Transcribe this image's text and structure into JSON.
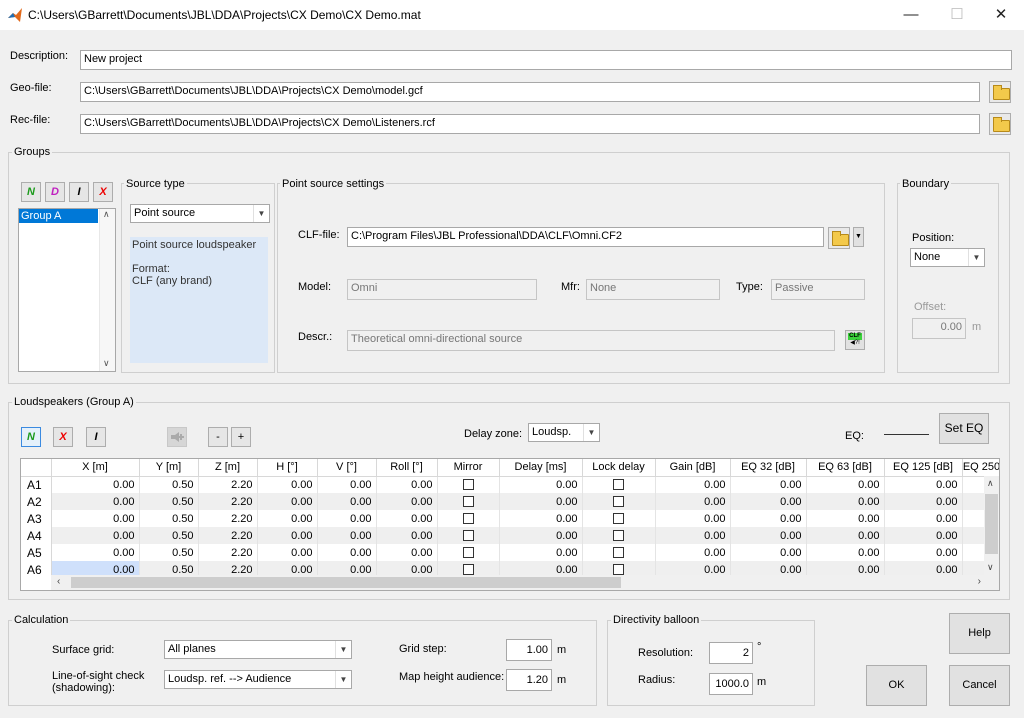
{
  "window": {
    "title": "C:\\Users\\GBarrett\\Documents\\JBL\\DDA\\Projects\\CX Demo\\CX Demo.mat",
    "min": "—",
    "max": "☐",
    "close": "✕"
  },
  "files": {
    "description_label": "Description:",
    "description_value": "New project",
    "geo_label": "Geo-file:",
    "geo_value": "C:\\Users\\GBarrett\\Documents\\JBL\\DDA\\Projects\\CX Demo\\model.gcf",
    "rec_label": "Rec-file:",
    "rec_value": "C:\\Users\\GBarrett\\Documents\\JBL\\DDA\\Projects\\CX Demo\\Listeners.rcf"
  },
  "groups": {
    "label": "Groups",
    "buttons": {
      "new": "N",
      "dup": "D",
      "info": "I",
      "del": "X"
    },
    "items": [
      "Group A"
    ],
    "source_type": {
      "label": "Source type",
      "selected": "Point source",
      "desc_line1": "Point source loudspeaker",
      "desc_line2": "Format:",
      "desc_line3": "CLF (any brand)"
    },
    "point_source": {
      "label": "Point source settings",
      "clf_label": "CLF-file:",
      "clf_value": "C:\\Program Files\\JBL Professional\\DDA\\CLF\\Omni.CF2",
      "model_label": "Model:",
      "model_value": "Omni",
      "mfr_label": "Mfr:",
      "mfr_value": "None",
      "type_label": "Type:",
      "type_value": "Passive",
      "descr_label": "Descr.:",
      "descr_value": "Theoretical omni-directional source",
      "clf_icon_text": "CLF"
    },
    "boundary": {
      "label": "Boundary",
      "position_label": "Position:",
      "position_value": "None",
      "offset_label": "Offset:",
      "offset_value": "0.00",
      "offset_unit": "m"
    }
  },
  "loudspeakers": {
    "label": "Loudspeakers (Group A)",
    "buttons": {
      "new": "N",
      "del": "X",
      "info": "I",
      "minus": "-",
      "plus": "+",
      "set_eq": "Set EQ"
    },
    "delay_zone_label": "Delay zone:",
    "delay_zone_value": "Loudsp.",
    "eq_label": "EQ:",
    "columns": [
      "X [m]",
      "Y [m]",
      "Z [m]",
      "H [°]",
      "V [°]",
      "Roll [°]",
      "Mirror",
      "Delay [ms]",
      "Lock delay",
      "Gain [dB]",
      "EQ 32 [dB]",
      "EQ 63 [dB]",
      "EQ 125 [dB]",
      "EQ 250"
    ],
    "rows": [
      {
        "id": "A1",
        "x": "0.00",
        "y": "0.50",
        "z": "2.20",
        "h": "0.00",
        "v": "0.00",
        "roll": "0.00",
        "delay": "0.00",
        "gain": "0.00",
        "eq32": "0.00",
        "eq63": "0.00",
        "eq125": "0.00"
      },
      {
        "id": "A2",
        "x": "0.00",
        "y": "0.50",
        "z": "2.20",
        "h": "0.00",
        "v": "0.00",
        "roll": "0.00",
        "delay": "0.00",
        "gain": "0.00",
        "eq32": "0.00",
        "eq63": "0.00",
        "eq125": "0.00"
      },
      {
        "id": "A3",
        "x": "0.00",
        "y": "0.50",
        "z": "2.20",
        "h": "0.00",
        "v": "0.00",
        "roll": "0.00",
        "delay": "0.00",
        "gain": "0.00",
        "eq32": "0.00",
        "eq63": "0.00",
        "eq125": "0.00"
      },
      {
        "id": "A4",
        "x": "0.00",
        "y": "0.50",
        "z": "2.20",
        "h": "0.00",
        "v": "0.00",
        "roll": "0.00",
        "delay": "0.00",
        "gain": "0.00",
        "eq32": "0.00",
        "eq63": "0.00",
        "eq125": "0.00"
      },
      {
        "id": "A5",
        "x": "0.00",
        "y": "0.50",
        "z": "2.20",
        "h": "0.00",
        "v": "0.00",
        "roll": "0.00",
        "delay": "0.00",
        "gain": "0.00",
        "eq32": "0.00",
        "eq63": "0.00",
        "eq125": "0.00"
      },
      {
        "id": "A6",
        "x": "0.00",
        "y": "0.50",
        "z": "2.20",
        "h": "0.00",
        "v": "0.00",
        "roll": "0.00",
        "delay": "0.00",
        "gain": "0.00",
        "eq32": "0.00",
        "eq63": "0.00",
        "eq125": "0.00"
      }
    ]
  },
  "calculation": {
    "label": "Calculation",
    "surface_label": "Surface grid:",
    "surface_value": "All planes",
    "los_label1": "Line-of-sight check",
    "los_label2": "(shadowing):",
    "los_value": "Loudsp. ref. --> Audience",
    "grid_step_label": "Grid step:",
    "grid_step_value": "1.00",
    "grid_step_unit": "m",
    "map_height_label": "Map height audience:",
    "map_height_value": "1.20",
    "map_height_unit": "m"
  },
  "directivity": {
    "label": "Directivity balloon",
    "resolution_label": "Resolution:",
    "resolution_value": "2",
    "resolution_unit": "°",
    "radius_label": "Radius:",
    "radius_value": "1000.0",
    "radius_unit": "m"
  },
  "actions": {
    "help": "Help",
    "ok": "OK",
    "cancel": "Cancel"
  }
}
